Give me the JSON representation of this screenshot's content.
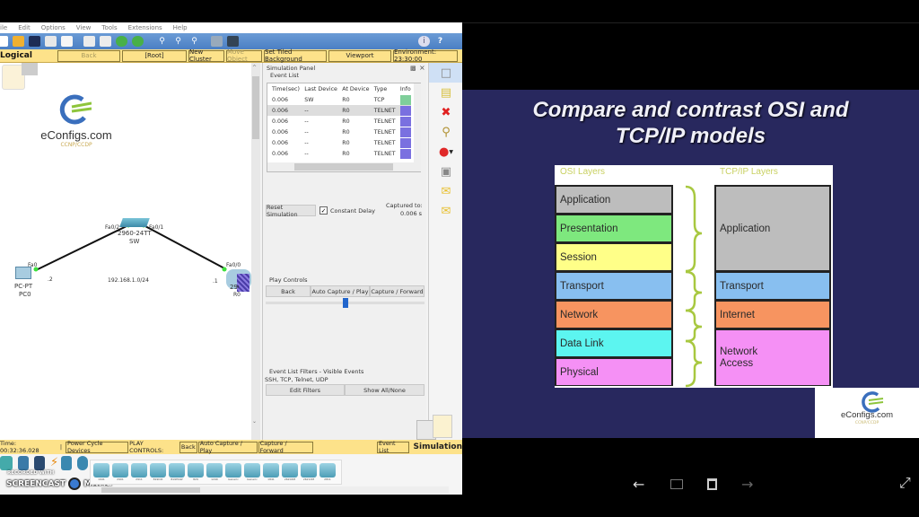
{
  "app": {
    "menu": [
      "ile",
      "Edit",
      "Options",
      "View",
      "Tools",
      "Extensions",
      "Help"
    ],
    "toolbar_icons": [
      "new-icon",
      "open-icon",
      "save-icon",
      "print-icon",
      "activity-wizard-icon",
      "copy-icon",
      "paste-icon",
      "undo-icon",
      "redo-icon",
      "zoom-in-icon",
      "zoom-reset-icon",
      "zoom-out-icon",
      "palette-icon",
      "custom-device-icon",
      "info-icon",
      "help-icon"
    ],
    "logical_bar": {
      "title": "Logical",
      "buttons": [
        "Back",
        "[Root]",
        "New Cluster",
        "Move Object",
        "Set Tiled Background",
        "Viewport",
        "Environment: 23:30:00"
      ]
    },
    "workspace": {
      "logo_text": "eConfigs.com",
      "logo_sub": "CCNP/CCDP",
      "devices": [
        {
          "model": "2960-24TT",
          "name": "SW"
        },
        {
          "model": "PC-PT",
          "name": "PC0"
        },
        {
          "model": "2901",
          "name": "R0"
        }
      ],
      "ports": {
        "sw_left": "Fa0/2",
        "sw_right": "Fa0/1",
        "pc": "Fa0",
        "router": "Fa0/0"
      },
      "network_label": "192.168.1.0/24",
      "pc_ip_suffix": ".2",
      "router_ip_suffix": ".1"
    },
    "sim_panel": {
      "title": "Simulation Panel",
      "event_list_label": "Event List",
      "columns": [
        "Time(sec)",
        "Last Device",
        "At Device",
        "Type",
        "Info"
      ],
      "events": [
        {
          "time": "0.006",
          "last": "SW",
          "at": "R0",
          "type": "TCP",
          "color": "#7fcf9a"
        },
        {
          "time": "0.006",
          "last": "--",
          "at": "R0",
          "type": "TELNET",
          "color": "#7a70e0"
        },
        {
          "time": "0.006",
          "last": "--",
          "at": "R0",
          "type": "TELNET",
          "color": "#7a70e0"
        },
        {
          "time": "0.006",
          "last": "--",
          "at": "R0",
          "type": "TELNET",
          "color": "#7a70e0"
        },
        {
          "time": "0.006",
          "last": "--",
          "at": "R0",
          "type": "TELNET",
          "color": "#7a70e0"
        },
        {
          "time": "0.006",
          "last": "--",
          "at": "R0",
          "type": "TELNET",
          "color": "#7a70e0"
        }
      ],
      "reset_label": "Reset Simulation",
      "constant_delay_label": "Constant Delay",
      "constant_delay_checked": true,
      "captured_label": "Captured to:",
      "captured_value": "0.006 s",
      "play_controls_label": "Play Controls",
      "play_buttons": [
        "Back",
        "Auto Capture / Play",
        "Capture / Forward"
      ],
      "speed_slider": 0.5,
      "filters_label": "Event List Filters - Visible Events",
      "filters_value": "SSH, TCP, Telnet, UDP",
      "edit_filters_label": "Edit Filters",
      "show_all_label": "Show All/None"
    },
    "side_tools": [
      "select-icon",
      "note-icon",
      "delete-icon",
      "inspect-icon",
      "draw-shape-icon",
      "resize-icon",
      "simple-pdu-icon",
      "complex-pdu-icon"
    ],
    "status_bar": {
      "time": "Time: 00:32:36.028",
      "power_cycle": "Power Cycle Devices",
      "play_controls": "PLAY CONTROLS:",
      "back": "Back",
      "auto": "Auto Capture / Play",
      "forward": "Capture / Forward",
      "event_list": "Event List",
      "mode": "Simulation"
    },
    "device_models": [
      "1941",
      "2901",
      "2911",
      "819IOX",
      "819HGW",
      "829",
      "1240",
      "Generic",
      "Generic",
      "1841",
      "2620XM",
      "2621XM",
      "2811"
    ],
    "watermark": {
      "line1": "RECORDED WITH",
      "line2": "SCREENCAST",
      "line3": "MATIC"
    }
  },
  "slide": {
    "title_line1": "Compare and contrast OSI and",
    "title_line2": "TCP/IP models",
    "osi_header": "OSI Layers",
    "tcp_header": "TCP/IP Layers",
    "osi_layers": [
      {
        "name": "Application",
        "color": "#bdbdbd"
      },
      {
        "name": "Presentation",
        "color": "#7ee87e"
      },
      {
        "name": "Session",
        "color": "#ffff88"
      },
      {
        "name": "Transport",
        "color": "#88bff0"
      },
      {
        "name": "Network",
        "color": "#f79460"
      },
      {
        "name": "Data Link",
        "color": "#5cf5f0"
      },
      {
        "name": "Physical",
        "color": "#f590f5"
      }
    ],
    "tcp_layers": [
      {
        "name": "Application",
        "color": "#bdbdbd",
        "span": 3
      },
      {
        "name": "Transport",
        "color": "#88bff0",
        "span": 1
      },
      {
        "name": "Internet",
        "color": "#f79460",
        "span": 1
      },
      {
        "name": "Network Access",
        "color": "#f590f5",
        "span": 2
      }
    ],
    "logo_text": "eConfigs.com",
    "logo_sub": "CCNP/CCDP"
  },
  "viewer_controls": [
    "back-arrow-icon",
    "slide-icon",
    "trash-icon",
    "forward-arrow-icon",
    "fullscreen-icon"
  ]
}
